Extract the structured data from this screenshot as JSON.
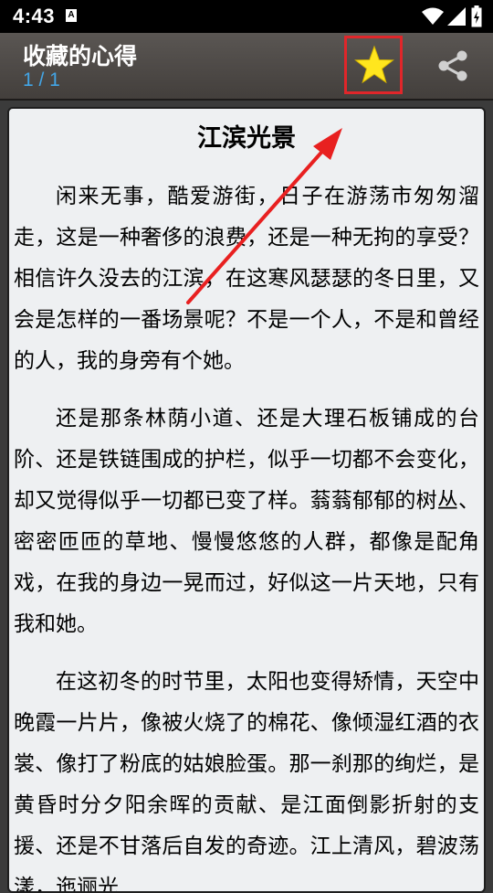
{
  "status_bar": {
    "time": "4:43",
    "notification_icon_letter": "A"
  },
  "app_bar": {
    "title": "收藏的心得",
    "subtitle": "1 / 1",
    "favorite_icon": "star-icon",
    "share_icon": "share-icon"
  },
  "article": {
    "title": "江滨光景",
    "paragraphs": [
      "闲来无事，酷爱游街，日子在游荡市匆匆溜走，这是一种奢侈的浪费，还是一种无拘的享受？相信许久没去的江滨，在这寒风瑟瑟的冬日里，又会是怎样的一番场景呢？不是一个人，不是和曾经的人，我的身旁有个她。",
      "还是那条林荫小道、还是大理石板铺成的台阶、还是铁链围成的护栏，似乎一切都不会变化，却又觉得似乎一切都已变了样。蓊蓊郁郁的树丛、密密匝匝的草地、慢慢悠悠的人群，都像是配角戏，在我的身边一晃而过，好似这一片天地，只有我和她。",
      "在这初冬的时节里，太阳也变得矫情，天空中晚霞一片片，像被火烧了的棉花、像倾湿红酒的衣裳、像打了粉底的姑娘脸蛋。那一刹那的绚烂，是黄昏时分夕阳余晖的贡献、是江面倒影折射的支援、还是不甘落后自发的奇迹。江上清风，碧波荡漾，迤逦光"
    ]
  },
  "colors": {
    "status_bar_bg": "#000000",
    "app_bar_bg": "#4d4946",
    "subtitle_blue": "#43a5e6",
    "star_yellow": "#ffe61e",
    "highlight_red": "#e0262a",
    "card_bg": "#eef0f2"
  }
}
